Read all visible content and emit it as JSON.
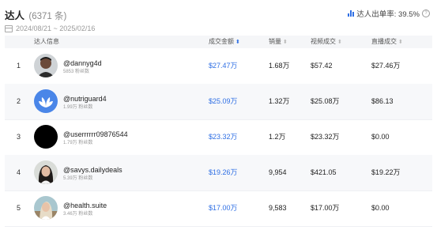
{
  "header": {
    "title": "达人",
    "count": "(6371 条)",
    "date_range": "2024/08/21 ~ 2025/02/16",
    "rate_label": "达人出单率: 39.5%"
  },
  "columns": [
    "达人信息",
    "成交金额",
    "销量",
    "视频成交",
    "直播成交"
  ],
  "rows": [
    {
      "rank": "1",
      "name": "@dannyg4d",
      "fans": "5853 粉丝数",
      "gmv": "$27.47万",
      "sales": "1.68万",
      "video": "$57.42",
      "live": "$27.46万"
    },
    {
      "rank": "2",
      "name": "@nutriguard4",
      "fans": "1.99万 粉丝数",
      "gmv": "$25.09万",
      "sales": "1.32万",
      "video": "$25.08万",
      "live": "$86.13"
    },
    {
      "rank": "3",
      "name": "@userrrrrr09876544",
      "fans": "1.79万 粉丝数",
      "gmv": "$23.32万",
      "sales": "1.2万",
      "video": "$23.32万",
      "live": "$0.00"
    },
    {
      "rank": "4",
      "name": "@savys.dailydeals",
      "fans": "5.39万 粉丝数",
      "gmv": "$19.26万",
      "sales": "9,954",
      "video": "$421.05",
      "live": "$19.22万"
    },
    {
      "rank": "5",
      "name": "@health.suite",
      "fans": "3.46万 粉丝数",
      "gmv": "$17.00万",
      "sales": "9,583",
      "video": "$17.00万",
      "live": "$0.00"
    }
  ],
  "colors": {
    "accent": "#2f6fe4",
    "header_bg": "#f5f6f8",
    "alt_row": "#f7f8fa"
  },
  "icons": [
    "bar-chart-icon",
    "help-icon",
    "calendar-icon",
    "sort-icon"
  ]
}
